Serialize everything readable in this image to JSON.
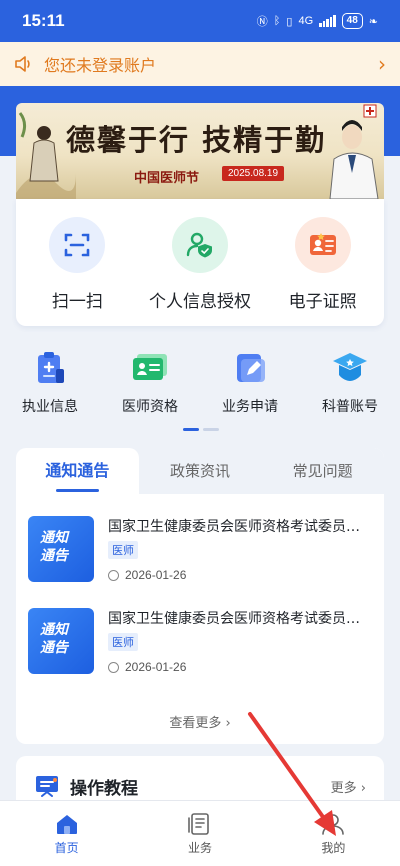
{
  "status_bar": {
    "time": "15:11",
    "network": "4G",
    "battery": "48"
  },
  "login_banner": {
    "text": "您还未登录账户"
  },
  "hero": {
    "title": "德馨于行 技精于勤",
    "festival": "中国医师节",
    "date": "2025.08.19"
  },
  "quick_actions": [
    {
      "label": "扫一扫",
      "icon": "scan-icon"
    },
    {
      "label": "个人信息授权",
      "icon": "user-shield-icon"
    },
    {
      "label": "电子证照",
      "icon": "license-icon"
    }
  ],
  "services": [
    {
      "label": "执业信息",
      "icon": "clipboard-icon"
    },
    {
      "label": "医师资格",
      "icon": "id-card-icon"
    },
    {
      "label": "业务申请",
      "icon": "edit-doc-icon"
    },
    {
      "label": "科普账号",
      "icon": "graduation-cap-icon"
    }
  ],
  "news": {
    "tabs": [
      "通知通告",
      "政策资讯",
      "常见问题"
    ],
    "active_tab": 0,
    "thumb_text": [
      "通知",
      "通告"
    ],
    "items": [
      {
        "title": "国家卫生健康委员会医师资格考试委员会公告",
        "tag": "医师",
        "date": "2026-01-26"
      },
      {
        "title": "国家卫生健康委员会医师资格考试委员会公告",
        "tag": "医师",
        "date": "2026-01-26"
      }
    ],
    "more": "查看更多"
  },
  "tutorial": {
    "title": "操作教程",
    "more": "更多"
  },
  "bottom_nav": [
    {
      "label": "首页",
      "icon": "home-icon",
      "active": true
    },
    {
      "label": "业务",
      "icon": "business-icon",
      "active": false
    },
    {
      "label": "我的",
      "icon": "profile-icon",
      "active": false
    }
  ],
  "colors": {
    "primary": "#2b62de",
    "banner_text": "#e07a1f",
    "annotation_arrow": "#e53935"
  }
}
